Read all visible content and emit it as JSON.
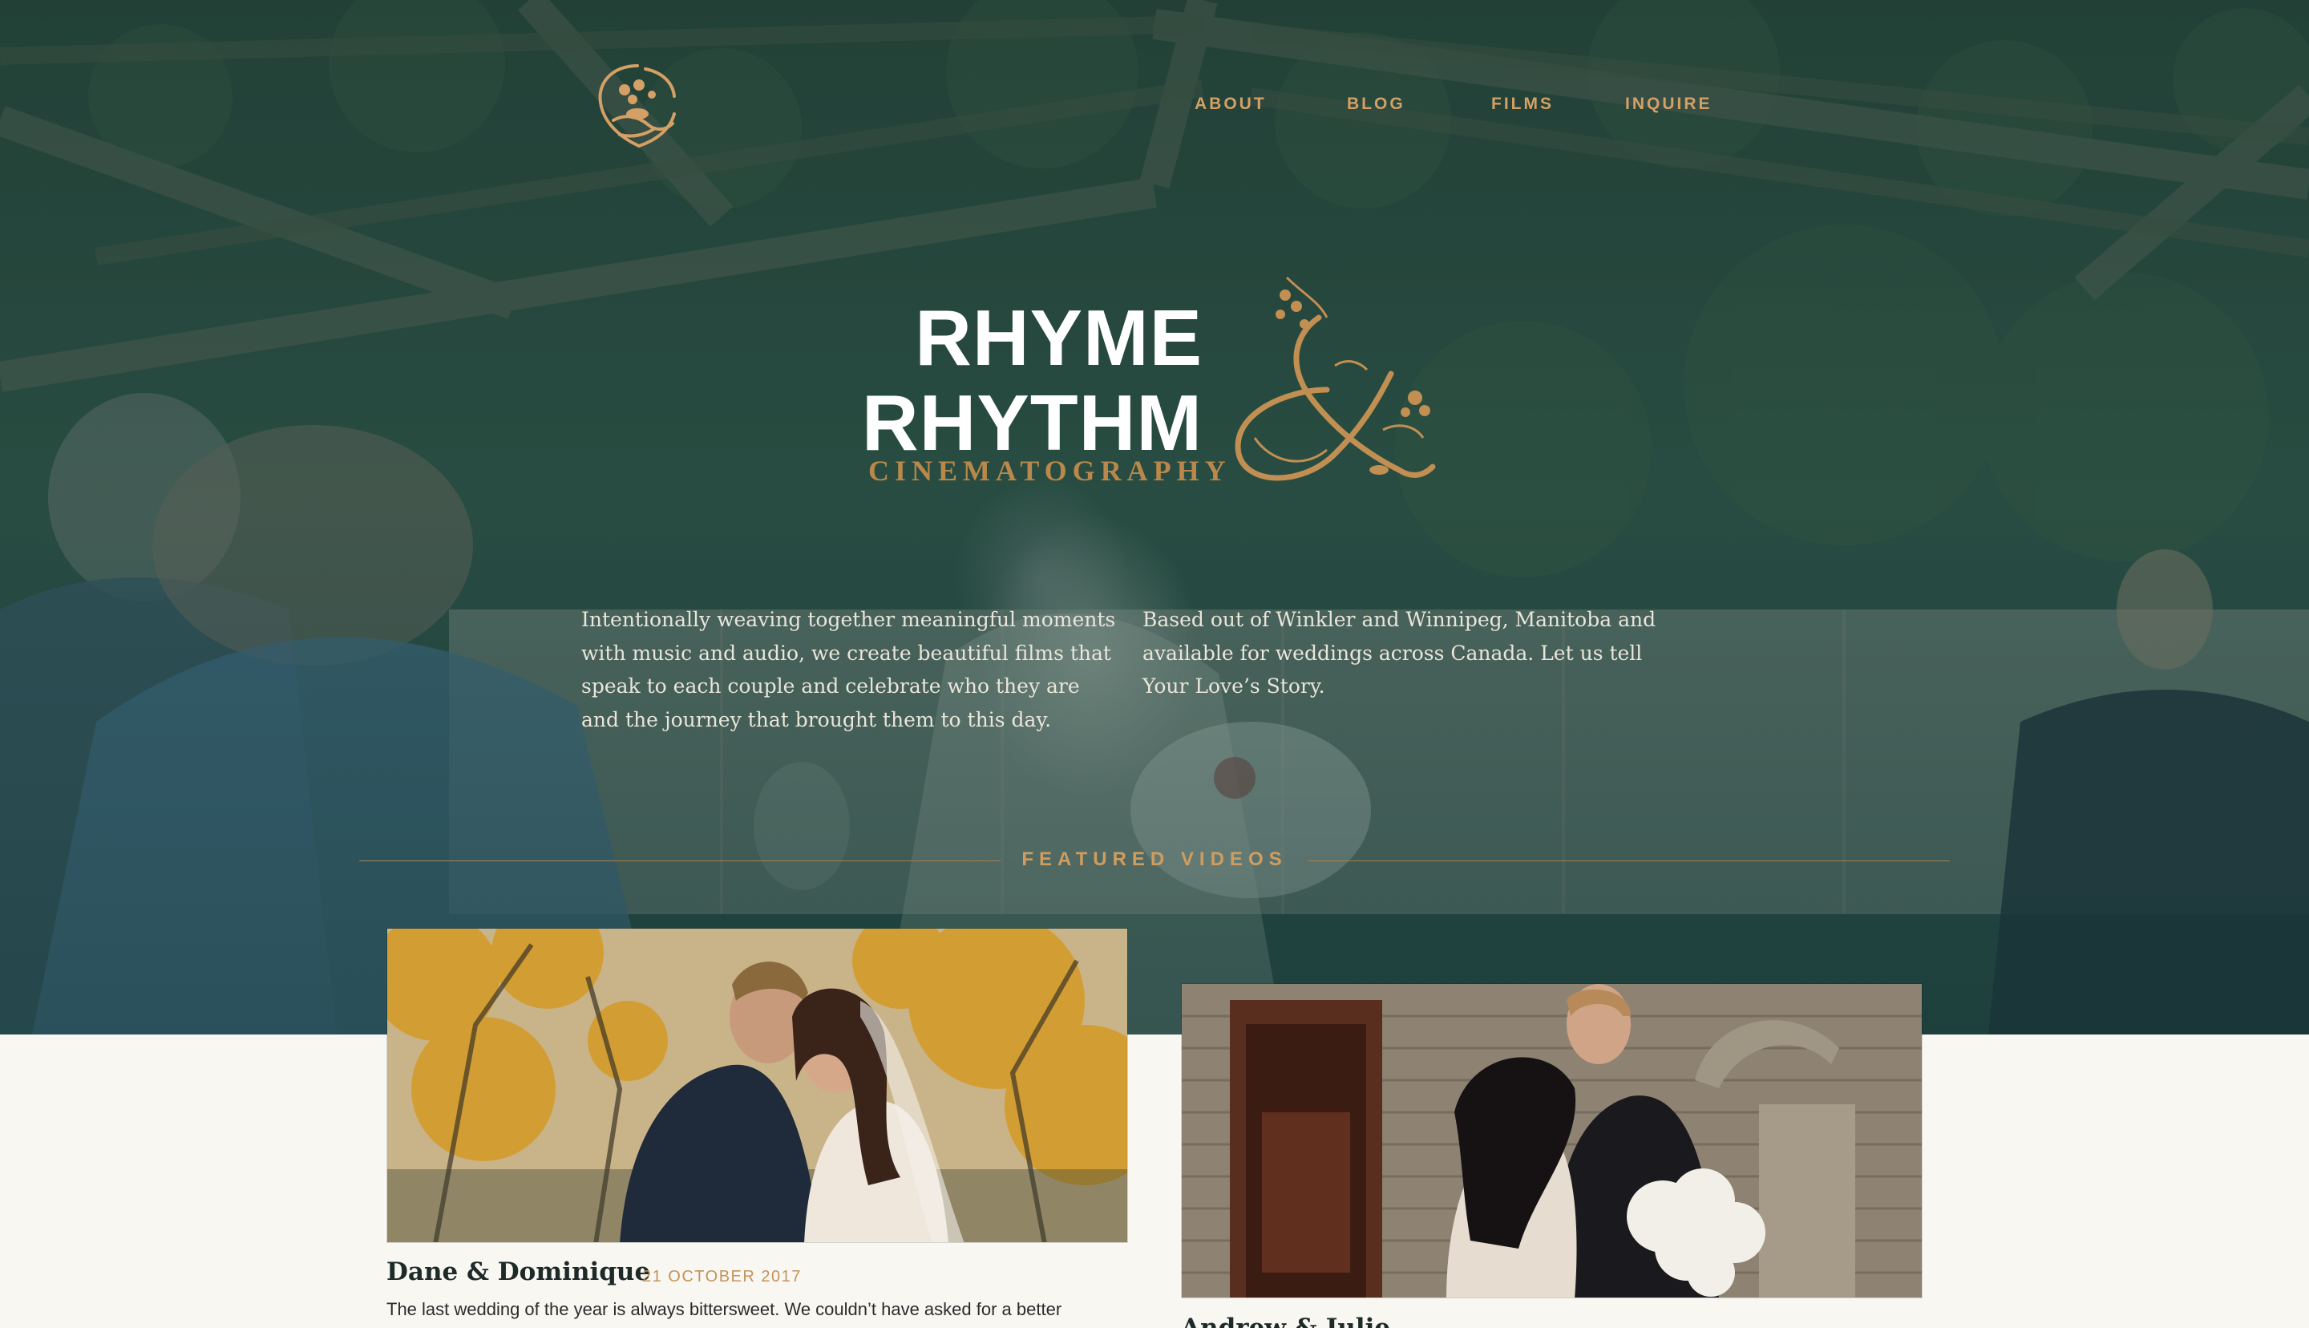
{
  "nav": {
    "items": [
      {
        "label": "ABOUT"
      },
      {
        "label": "BLOG"
      },
      {
        "label": "FILMS"
      },
      {
        "label": "INQUIRE"
      }
    ]
  },
  "brand": {
    "line1": "RHYME",
    "line2": "RHYTHM",
    "subtitle": "CINEMATOGRAPHY",
    "ampersand_icon": "ornate-ampersand-icon",
    "logo_icon": "floral-monogram-icon"
  },
  "intro": {
    "left": "Intentionally weaving together meaningful moments with music and audio, we create beautiful films that speak to each couple and celebrate who they are and the journey that brought them to this day.",
    "right": "Based out of Winkler and Winnipeg, Manitoba and available for weddings across Canada. Let us tell Your Love’s Story."
  },
  "featured": {
    "label": "FEATURED VIDEOS"
  },
  "videos": [
    {
      "title": "Dane & Dominique",
      "date": "21 OCTOBER 2017",
      "excerpt": "The last wedding of the year is always bittersweet. We couldn’t have asked for a better"
    },
    {
      "title": "Andrew & Julie",
      "date": "",
      "excerpt": ""
    }
  ],
  "colors": {
    "accent_gold": "#d4a065",
    "hero_green": "#1f3a34",
    "page_background": "#f8f7f2"
  }
}
